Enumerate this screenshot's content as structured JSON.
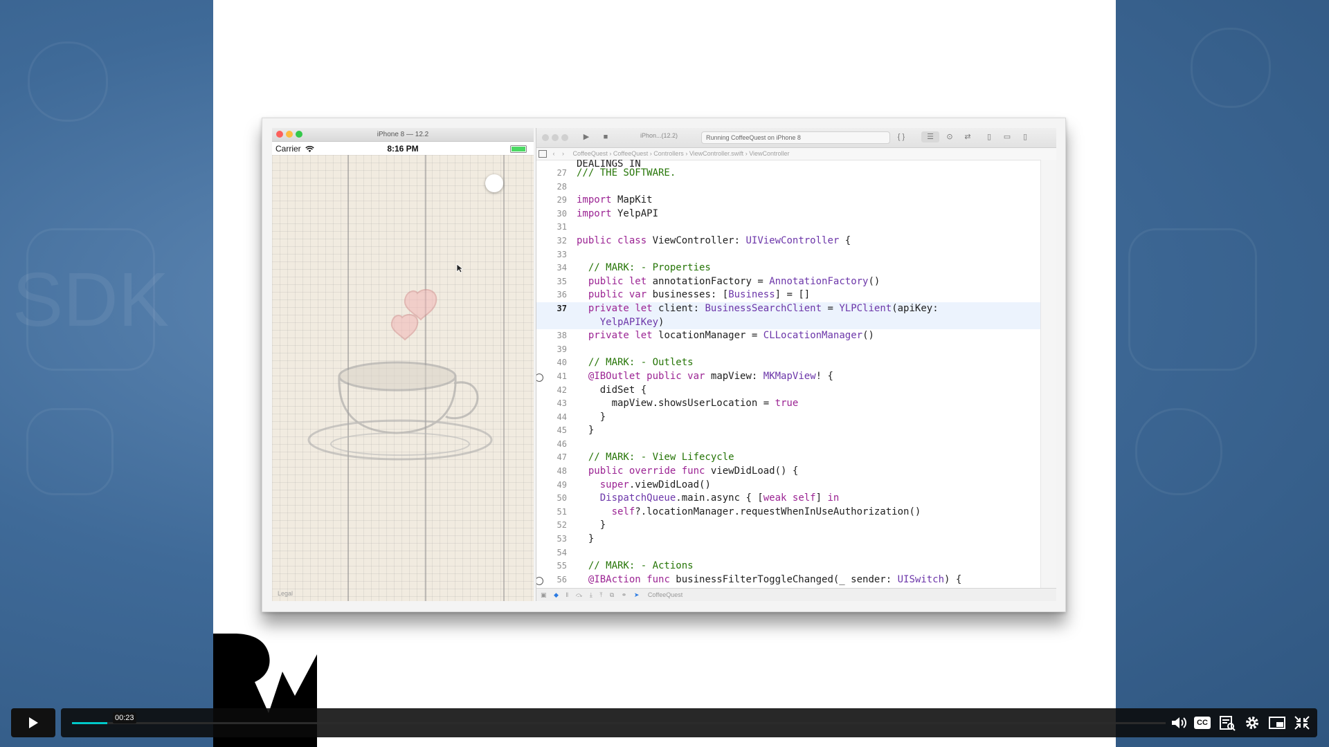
{
  "background": {
    "icons": [
      "sdk-icon",
      "swift-icon",
      "heart-icon",
      "lightbulb-icon",
      "compass-icon",
      "user-icon",
      "chart-icon",
      "gear-icon",
      "clock-icon",
      "pin-icon"
    ],
    "sdk_text": "SDK"
  },
  "simulator": {
    "window_title": "iPhone 8 — 12.2",
    "carrier": "Carrier",
    "time": "8:16 PM",
    "battery_level": 1.0,
    "legal_label": "Legal"
  },
  "xcode": {
    "scheme": "iPhon...(12.2)",
    "activity": "Running CoffeeQuest on iPhone 8",
    "jump_bar": [
      "CoffeeQuest",
      "CoffeeQuest",
      "Controllers",
      "ViewController.swift",
      "ViewController"
    ],
    "bottom_target": "CoffeeQuest",
    "top_partial_line": "DEALINGS IN",
    "lines": [
      {
        "n": "27",
        "text": "/// THE SOFTWARE."
      },
      {
        "n": "28",
        "text": ""
      },
      {
        "n": "29",
        "text": "import MapKit"
      },
      {
        "n": "30",
        "text": "import YelpAPI"
      },
      {
        "n": "31",
        "text": ""
      },
      {
        "n": "32",
        "text": "public class ViewController: UIViewController {"
      },
      {
        "n": "33",
        "text": ""
      },
      {
        "n": "34",
        "text": "  // MARK: - Properties"
      },
      {
        "n": "35",
        "text": "  public let annotationFactory = AnnotationFactory()"
      },
      {
        "n": "36",
        "text": "  public var businesses: [Business] = []"
      },
      {
        "n": "37",
        "text": "  private let client: BusinessSearchClient = YLPClient(apiKey:"
      },
      {
        "n": "",
        "text": "    YelpAPIKey)"
      },
      {
        "n": "38",
        "text": "  private let locationManager = CLLocationManager()"
      },
      {
        "n": "39",
        "text": ""
      },
      {
        "n": "40",
        "text": "  // MARK: - Outlets"
      },
      {
        "n": "41",
        "text": "  @IBOutlet public var mapView: MKMapView! {"
      },
      {
        "n": "42",
        "text": "    didSet {"
      },
      {
        "n": "43",
        "text": "      mapView.showsUserLocation = true"
      },
      {
        "n": "44",
        "text": "    }"
      },
      {
        "n": "45",
        "text": "  }"
      },
      {
        "n": "46",
        "text": ""
      },
      {
        "n": "47",
        "text": "  // MARK: - View Lifecycle"
      },
      {
        "n": "48",
        "text": "  public override func viewDidLoad() {"
      },
      {
        "n": "49",
        "text": "    super.viewDidLoad()"
      },
      {
        "n": "50",
        "text": "    DispatchQueue.main.async { [weak self] in"
      },
      {
        "n": "51",
        "text": "      self?.locationManager.requestWhenInUseAuthorization()"
      },
      {
        "n": "52",
        "text": "    }"
      },
      {
        "n": "53",
        "text": "  }"
      },
      {
        "n": "54",
        "text": ""
      },
      {
        "n": "55",
        "text": "  // MARK: - Actions"
      },
      {
        "n": "56",
        "text": "  @IBAction func businessFilterToggleChanged(_ sender: UISwitch) {"
      }
    ]
  },
  "player": {
    "current_time": "00:23",
    "progress_fraction": 0.032,
    "accent_color": "#00c8c8",
    "controls": [
      "play-icon",
      "volume-icon",
      "captions-icon",
      "transcript-icon",
      "settings-icon",
      "pip-icon",
      "fullscreen-exit-icon"
    ],
    "captions_label": "CC"
  }
}
